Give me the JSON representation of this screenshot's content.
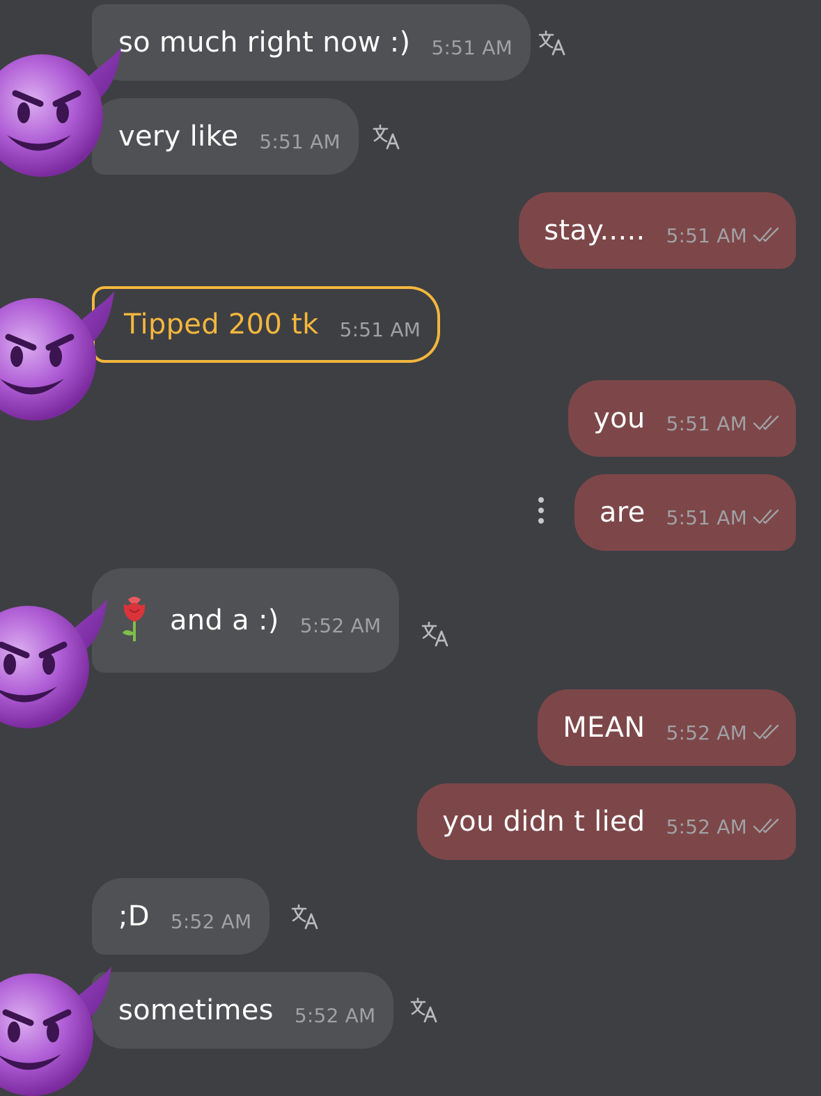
{
  "messages": [
    {
      "text": "so much right now :)",
      "time": "5:51 AM",
      "direction": "received"
    },
    {
      "text": "very like",
      "time": "5:51 AM",
      "direction": "received"
    },
    {
      "text": "stay.....",
      "time": "5:51 AM",
      "direction": "sent"
    },
    {
      "text": "Tipped 200 tk",
      "time": "5:51 AM",
      "direction": "received-tip"
    },
    {
      "text": "you",
      "time": "5:51 AM",
      "direction": "sent"
    },
    {
      "text": "are",
      "time": "5:51 AM",
      "direction": "sent"
    },
    {
      "text": "and a :)",
      "time": "5:52 AM",
      "direction": "received",
      "emoji": "rose"
    },
    {
      "text": "MEAN",
      "time": "5:52 AM",
      "direction": "sent"
    },
    {
      "text": "you didn t lied",
      "time": "5:52 AM",
      "direction": "sent"
    },
    {
      "text": ";D",
      "time": "5:52 AM",
      "direction": "received"
    },
    {
      "text": "sometimes",
      "time": "5:52 AM",
      "direction": "received"
    }
  ],
  "icons": {
    "avatar": "smiling-devil-emoji",
    "translate": "translate-icon",
    "read_receipt": "double-check-icon",
    "more": "more-vertical-icon",
    "rose": "rose-emoji"
  },
  "colors": {
    "background": "#3e3f43",
    "received_bubble": "#505154",
    "sent_bubble": "#7d4749",
    "tip_accent": "#f4b73d",
    "timestamp": "#a0a1a5"
  }
}
